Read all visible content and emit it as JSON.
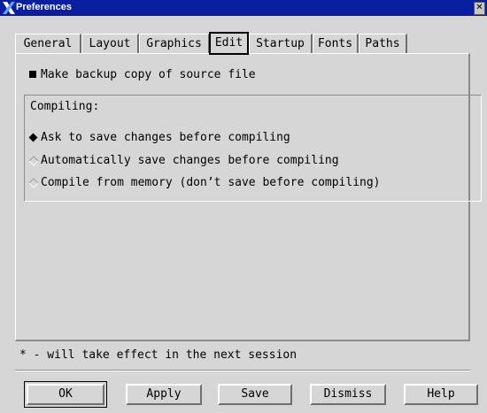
{
  "window": {
    "title": "Preferences",
    "close_glyph": "✕"
  },
  "tabs": [
    {
      "label": "General",
      "active": false
    },
    {
      "label": "Layout",
      "active": false
    },
    {
      "label": "Graphics",
      "active": false
    },
    {
      "label": "Edit",
      "active": true
    },
    {
      "label": "Startup",
      "active": false
    },
    {
      "label": "Fonts",
      "active": false
    },
    {
      "label": "Paths",
      "active": false
    }
  ],
  "edit": {
    "backup_label": "Make backup copy of source file",
    "backup_checked": true,
    "compiling": {
      "title": "Compiling:",
      "options": [
        {
          "label": "Ask to save changes before compiling",
          "selected": true
        },
        {
          "label": "Automatically save changes before compiling",
          "selected": false
        },
        {
          "label": "Compile from memory (don’t save before compiling)",
          "selected": false
        }
      ]
    }
  },
  "footer_note": "* - will take effect in the next session",
  "buttons": {
    "ok": "OK",
    "apply": "Apply",
    "save": "Save",
    "dismiss": "Dismiss",
    "help": "Help"
  }
}
